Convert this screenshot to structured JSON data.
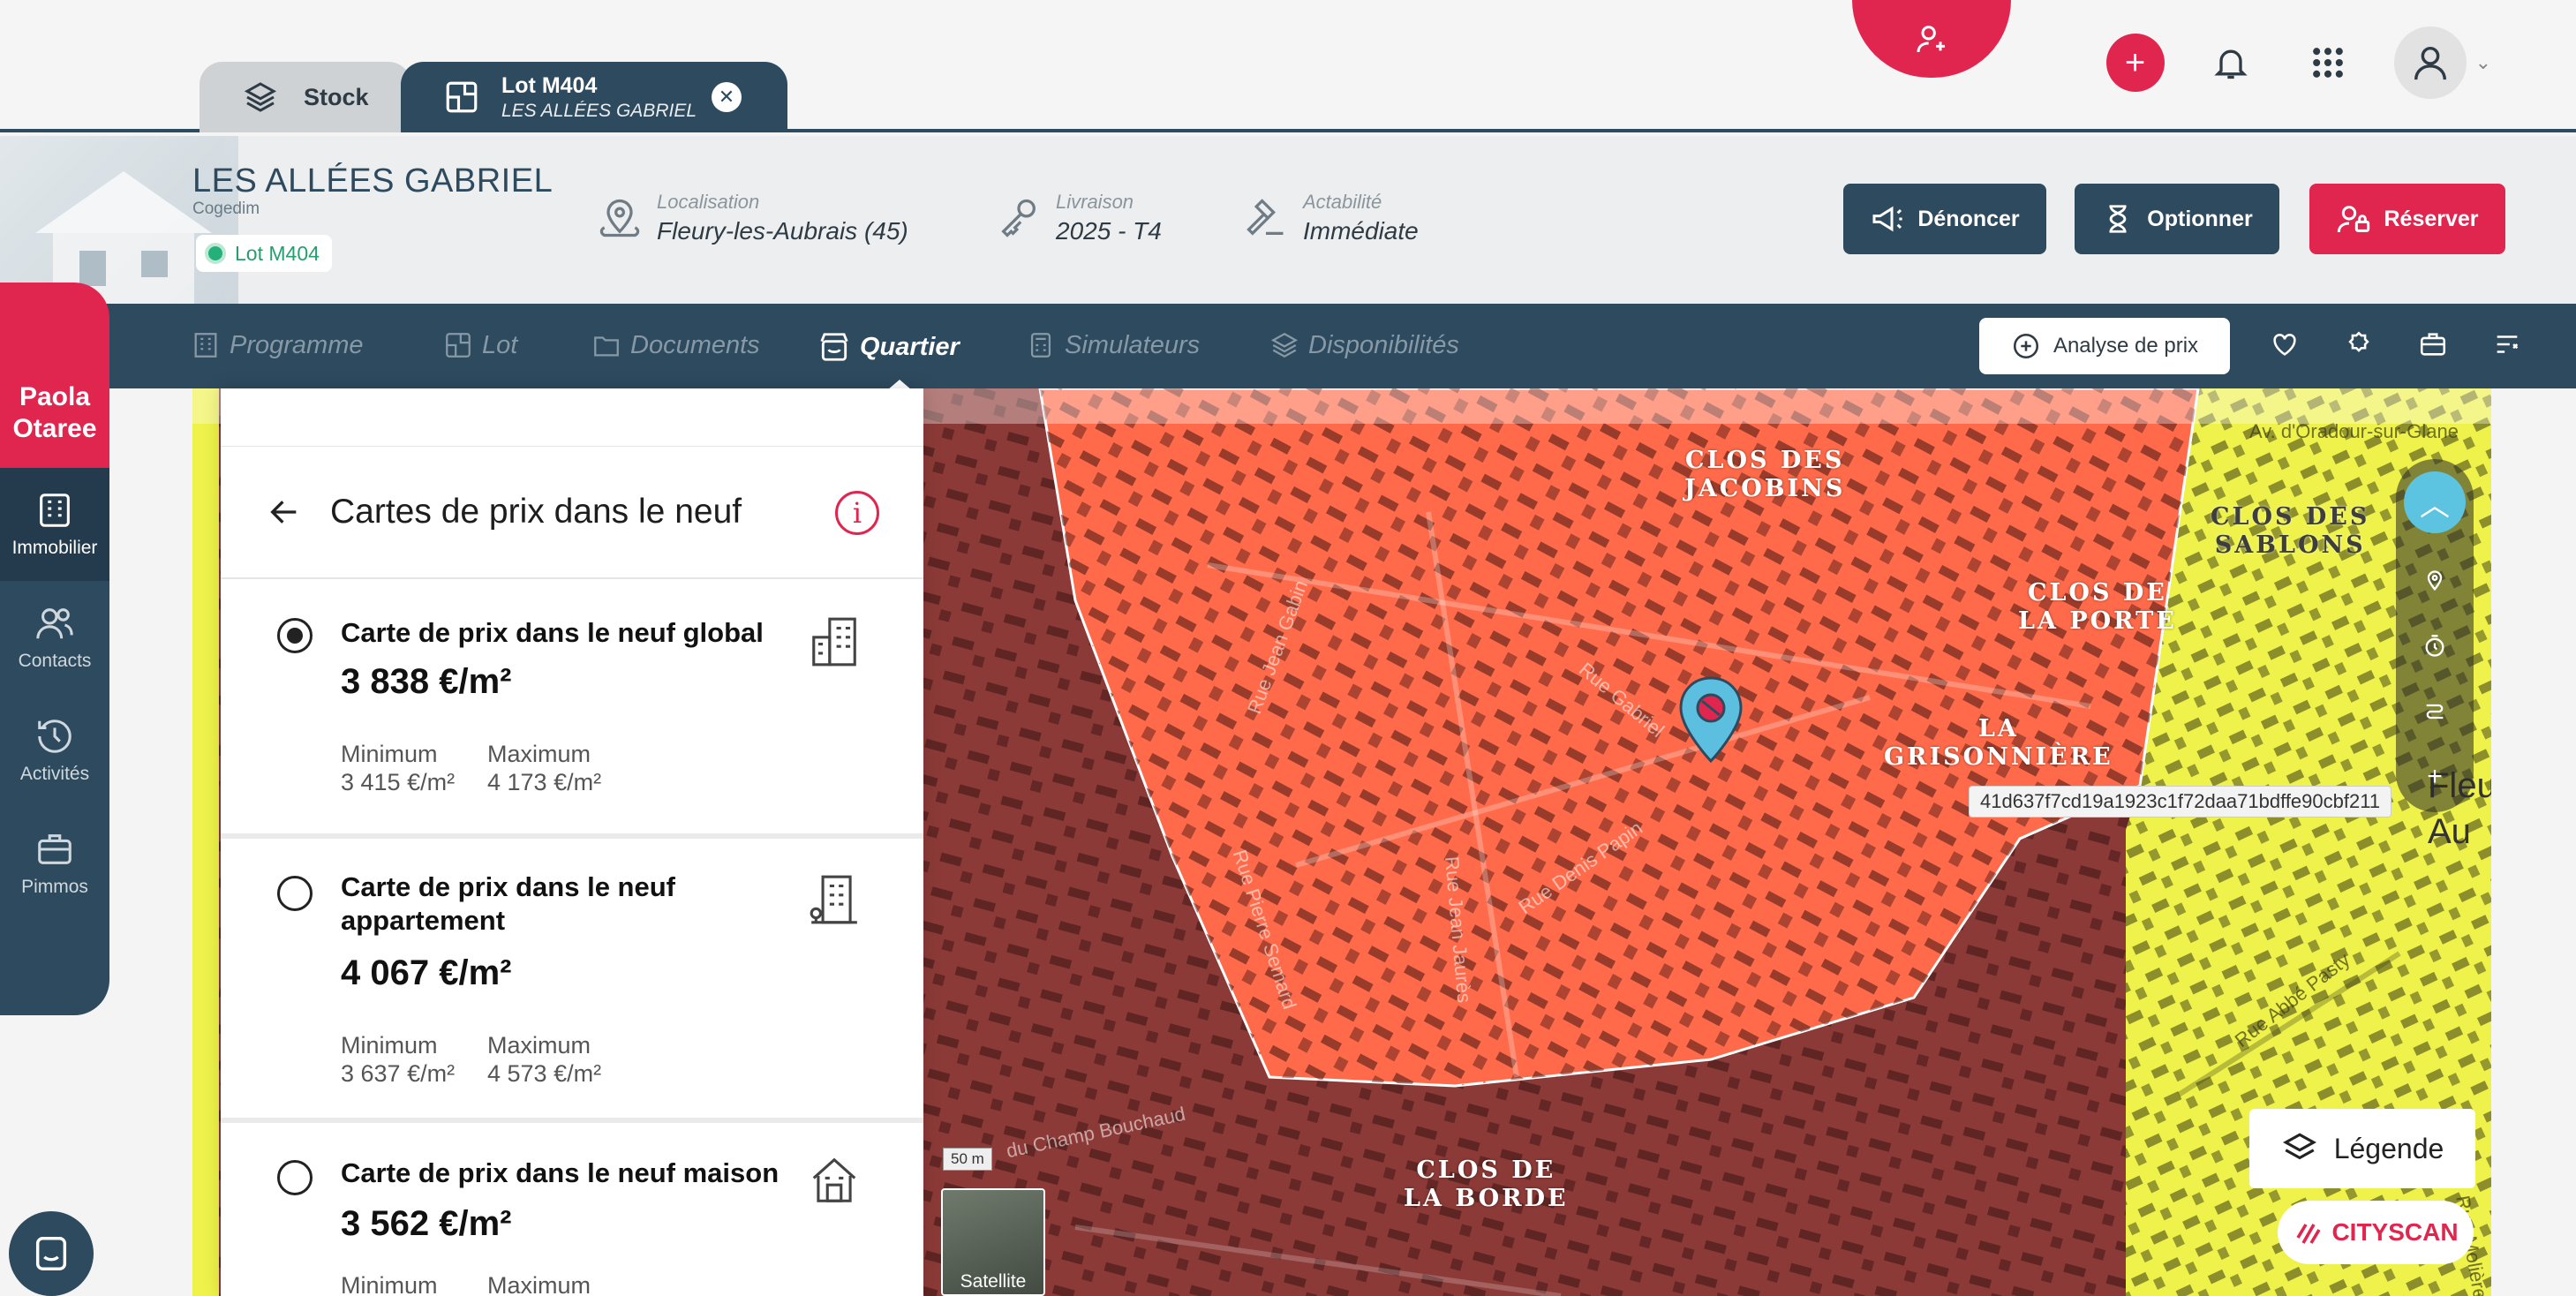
{
  "tabs": [
    {
      "label": "Stock"
    },
    {
      "label": "Lot M404",
      "sub": "LES ALLÉES GABRIEL"
    }
  ],
  "header": {
    "program": "LES ALLÉES GABRIEL",
    "promoter": "Cogedim",
    "lot_badge": "Lot M404",
    "localisation_label": "Localisation",
    "localisation_value": "Fleury-les-Aubrais (45)",
    "livraison_label": "Livraison",
    "livraison_value": "2025 - T4",
    "actabilite_label": "Actabilité",
    "actabilite_value": "Immédiate",
    "btn_denoncer": "Dénoncer",
    "btn_optionner": "Optionner",
    "btn_reserver": "Réserver"
  },
  "subnav": {
    "items": [
      "Programme",
      "Lot",
      "Documents",
      "Quartier",
      "Simulateurs",
      "Disponibilités"
    ],
    "active": "Quartier",
    "analyse": "Analyse de prix"
  },
  "sidebar": {
    "user_first": "Paola",
    "user_last": "Otaree",
    "items": [
      "Immobilier",
      "Contacts",
      "Activités",
      "Pimmos"
    ]
  },
  "panel": {
    "title": "Cartes de prix dans le neuf",
    "min_label": "Minimum",
    "max_label": "Maximum",
    "cards": [
      {
        "title": "Carte de prix dans le neuf global",
        "price": "3 838 €/m²",
        "min": "3 415 €/m²",
        "max": "4 173 €/m²",
        "checked": true
      },
      {
        "title": "Carte de prix dans le neuf appartement",
        "price": "4 067 €/m²",
        "min": "3 637 €/m²",
        "max": "4 573 €/m²",
        "checked": false
      },
      {
        "title": "Carte de prix dans le neuf maison",
        "price": "3 562 €/m²",
        "min": "Minimum",
        "max": "Maximum",
        "checked": false
      }
    ]
  },
  "map": {
    "places": [
      "CLOS DES JACOBINS",
      "CLOS DES SABLONS",
      "CLOS DE LA PORTE",
      "LA GRISONNIÈRE",
      "CLOS DE LA BORDE"
    ],
    "streets": [
      "Rue Jean Gabin",
      "Rue Gabriel",
      "Rue Denis Papin",
      "Rue Jean Jaurès",
      "Rue Pierre Semard",
      "Rue Abbé Pasty",
      "Av. d'Oradour-sur-Glane",
      "du Champ Bouchaud",
      "Rue Molière"
    ],
    "tooltip": "41d637f7cd19a1923c1f72daa71bdffe90cbf211",
    "city_label_1": "Fleu",
    "city_label_2": "Au",
    "scale": "50 m",
    "satellite": "Satellite",
    "legend": "Légende",
    "brand": "CITYSCAN",
    "colors": {
      "zone_main": "#ff6b4a",
      "zone_dark": "#8c3a37",
      "zone_yellow": "#eef24a"
    }
  }
}
